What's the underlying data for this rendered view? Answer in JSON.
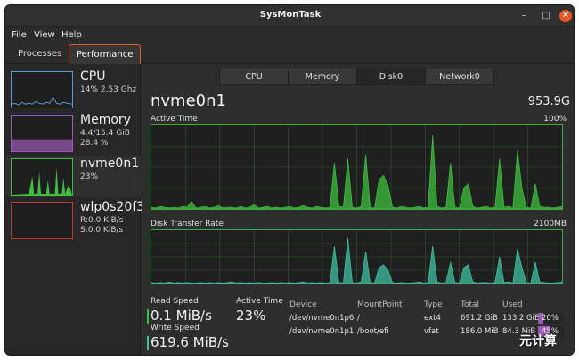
{
  "window": {
    "title": "SysMonTask"
  },
  "menu": [
    {
      "label": "File"
    },
    {
      "label": "View"
    },
    {
      "label": "Help"
    }
  ],
  "tabs": [
    {
      "label": "Processes"
    },
    {
      "label": "Performance"
    }
  ],
  "sidebar": {
    "items": [
      {
        "name": "CPU",
        "line1": "14% 2.53 Ghz",
        "line2": "",
        "color": "#5b9bd5"
      },
      {
        "name": "Memory",
        "line1": "4.4/15.4 GiB",
        "line2": "28.4 %",
        "color": "#9b59b6"
      },
      {
        "name": "nvme0n1",
        "line1": "23%",
        "line2": "",
        "color": "#3fbf3f"
      },
      {
        "name": "wlp0s20f3",
        "line1": "R:0.0 KiB/s",
        "line2": "S:0.0 KiB/s",
        "color": "#c0392b"
      }
    ]
  },
  "subtabs": [
    {
      "label": "CPU"
    },
    {
      "label": "Memory"
    },
    {
      "label": "Disk0"
    },
    {
      "label": "Network0"
    }
  ],
  "device": {
    "name": "nvme0n1",
    "size": "953.9G"
  },
  "active_time": {
    "label": "Active Time",
    "max": "100%"
  },
  "transfer_rate": {
    "label": "Disk Transfer Rate",
    "max": "2100MB"
  },
  "stats": {
    "read_label": "Read Speed",
    "read_value": "0.1 MiB/s",
    "active_label": "Active Time",
    "active_value": "23%",
    "write_label": "Write Speed",
    "write_value": "619.6 MiB/s",
    "read_color": "#3fbf3f",
    "write_color": "#3fbfa0"
  },
  "partitions": {
    "headers": [
      "Device",
      "MountPoint",
      "Type",
      "Total",
      "Used"
    ],
    "rows": [
      {
        "device": "/dev/nvme0n1p6",
        "mount": "/",
        "type": "ext4",
        "total": "691.2 GiB",
        "used": "133.2 GiB",
        "percent": "20%",
        "fraction": 0.2
      },
      {
        "device": "/dev/nvme0n1p1",
        "mount": "/boot/efi",
        "type": "vfat",
        "total": "186.0 MiB",
        "used": "84.3 MiB",
        "percent": "45%",
        "fraction": 0.45
      }
    ]
  },
  "watermark": "元计算",
  "series": {
    "active_time": [
      2,
      1,
      3,
      2,
      1,
      2,
      1,
      3,
      2,
      9,
      1,
      2,
      3,
      1,
      2,
      4,
      1,
      2,
      2,
      1,
      3,
      1,
      2,
      5,
      1,
      2,
      3,
      1,
      2,
      1,
      2,
      3,
      1,
      2,
      4,
      2,
      1,
      3,
      2,
      1,
      2,
      55,
      3,
      2,
      60,
      2,
      1,
      3,
      65,
      2,
      1,
      35,
      40,
      28,
      2,
      1,
      3,
      2,
      1,
      2,
      3,
      1,
      2,
      88,
      3,
      1,
      2,
      55,
      2,
      1,
      25,
      30,
      3,
      1,
      2,
      3,
      1,
      2,
      60,
      2,
      3,
      1,
      70,
      25,
      2,
      1,
      30,
      3,
      2,
      2,
      1,
      2,
      3
    ],
    "transfer": [
      2,
      1,
      2,
      1,
      3,
      1,
      2,
      1,
      2,
      1,
      1,
      2,
      1,
      2,
      1,
      2,
      1,
      2,
      3,
      1,
      2,
      1,
      2,
      1,
      2,
      1,
      1,
      2,
      1,
      2,
      1,
      2,
      1,
      2,
      3,
      1,
      2,
      1,
      2,
      1,
      2,
      70,
      2,
      1,
      85,
      2,
      1,
      3,
      60,
      2,
      1,
      30,
      35,
      25,
      2,
      1,
      2,
      1,
      1,
      2,
      3,
      1,
      2,
      70,
      3,
      1,
      2,
      40,
      2,
      1,
      30,
      35,
      3,
      1,
      2,
      2,
      1,
      2,
      50,
      2,
      3,
      1,
      65,
      30,
      2,
      1,
      40,
      3,
      2,
      1,
      1,
      2,
      3
    ]
  }
}
